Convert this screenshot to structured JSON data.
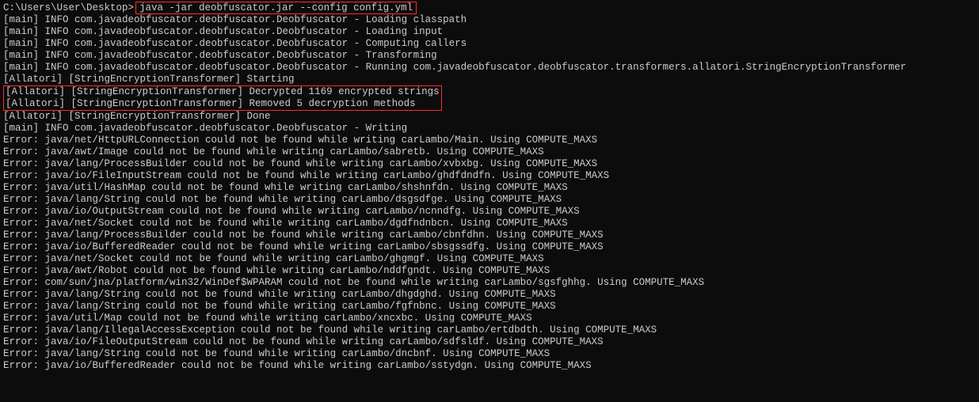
{
  "prompt": "C:\\Users\\User\\Desktop>",
  "command": "java -jar deobfuscator.jar --config config.yml",
  "logs": [
    "[main] INFO com.javadeobfuscator.deobfuscator.Deobfuscator - Loading classpath",
    "[main] INFO com.javadeobfuscator.deobfuscator.Deobfuscator - Loading input",
    "[main] INFO com.javadeobfuscator.deobfuscator.Deobfuscator - Computing callers",
    "[main] INFO com.javadeobfuscator.deobfuscator.Deobfuscator - Transforming",
    "[main] INFO com.javadeobfuscator.deobfuscator.Deobfuscator - Running com.javadeobfuscator.deobfuscator.transformers.allatori.StringEncryptionTransformer",
    "[Allatori] [StringEncryptionTransformer] Starting"
  ],
  "highlighted": [
    "[Allatori] [StringEncryptionTransformer] Decrypted 1169 encrypted strings",
    "[Allatori] [StringEncryptionTransformer] Removed 5 decryption methods"
  ],
  "logs2": [
    "[Allatori] [StringEncryptionTransformer] Done",
    "[main] INFO com.javadeobfuscator.deobfuscator.Deobfuscator - Writing",
    "Error: java/net/HttpURLConnection could not be found while writing carLambo/Main. Using COMPUTE_MAXS",
    "Error: java/awt/Image could not be found while writing carLambo/sabretb. Using COMPUTE_MAXS",
    "Error: java/lang/ProcessBuilder could not be found while writing carLambo/xvbxbg. Using COMPUTE_MAXS",
    "Error: java/io/FileInputStream could not be found while writing carLambo/ghdfdndfn. Using COMPUTE_MAXS",
    "Error: java/util/HashMap could not be found while writing carLambo/shshnfdn. Using COMPUTE_MAXS",
    "Error: java/lang/String could not be found while writing carLambo/dsgsdfge. Using COMPUTE_MAXS",
    "Error: java/io/OutputStream could not be found while writing carLambo/ncnndfg. Using COMPUTE_MAXS",
    "Error: java/net/Socket could not be found while writing carLambo/dgdfndnbcn. Using COMPUTE_MAXS",
    "Error: java/lang/ProcessBuilder could not be found while writing carLambo/cbnfdhn. Using COMPUTE_MAXS",
    "Error: java/io/BufferedReader could not be found while writing carLambo/sbsgssdfg. Using COMPUTE_MAXS",
    "Error: java/net/Socket could not be found while writing carLambo/ghgmgf. Using COMPUTE_MAXS",
    "Error: java/awt/Robot could not be found while writing carLambo/nddfgndt. Using COMPUTE_MAXS",
    "Error: com/sun/jna/platform/win32/WinDef$WPARAM could not be found while writing carLambo/sgsfghhg. Using COMPUTE_MAXS",
    "Error: java/lang/String could not be found while writing carLambo/dhgdghd. Using COMPUTE_MAXS",
    "Error: java/lang/String could not be found while writing carLambo/fgfnbnc. Using COMPUTE_MAXS",
    "Error: java/util/Map could not be found while writing carLambo/xncxbc. Using COMPUTE_MAXS",
    "Error: java/lang/IllegalAccessException could not be found while writing carLambo/ertdbdth. Using COMPUTE_MAXS",
    "Error: java/io/FileOutputStream could not be found while writing carLambo/sdfsldf. Using COMPUTE_MAXS",
    "Error: java/lang/String could not be found while writing carLambo/dncbnf. Using COMPUTE_MAXS",
    "Error: java/io/BufferedReader could not be found while writing carLambo/sstydgn. Using COMPUTE_MAXS"
  ]
}
